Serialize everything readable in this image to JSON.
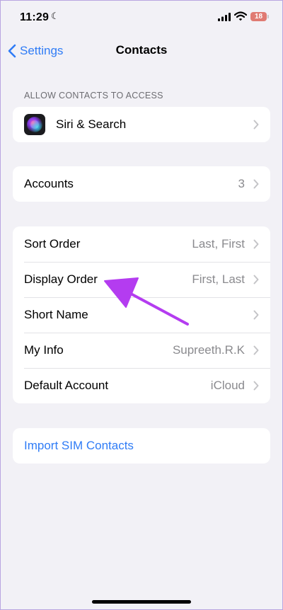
{
  "status_bar": {
    "time": "11:29",
    "battery": "18"
  },
  "nav": {
    "back_label": "Settings",
    "title": "Contacts"
  },
  "access_section": {
    "header": "ALLOW CONTACTS TO ACCESS",
    "items": [
      {
        "label": "Siri & Search",
        "icon": "siri-icon"
      }
    ]
  },
  "accounts_section": {
    "items": [
      {
        "label": "Accounts",
        "value": "3"
      }
    ]
  },
  "options_section": {
    "items": [
      {
        "label": "Sort Order",
        "value": "Last, First"
      },
      {
        "label": "Display Order",
        "value": "First, Last"
      },
      {
        "label": "Short Name",
        "value": ""
      },
      {
        "label": "My Info",
        "value": "Supreeth.R.K"
      },
      {
        "label": "Default Account",
        "value": "iCloud"
      }
    ]
  },
  "import_section": {
    "label": "Import SIM Contacts"
  },
  "colors": {
    "accent": "#2f7cf6",
    "background": "#f2f1f6",
    "annotation": "#b43cf0",
    "battery": "#e07a72"
  }
}
